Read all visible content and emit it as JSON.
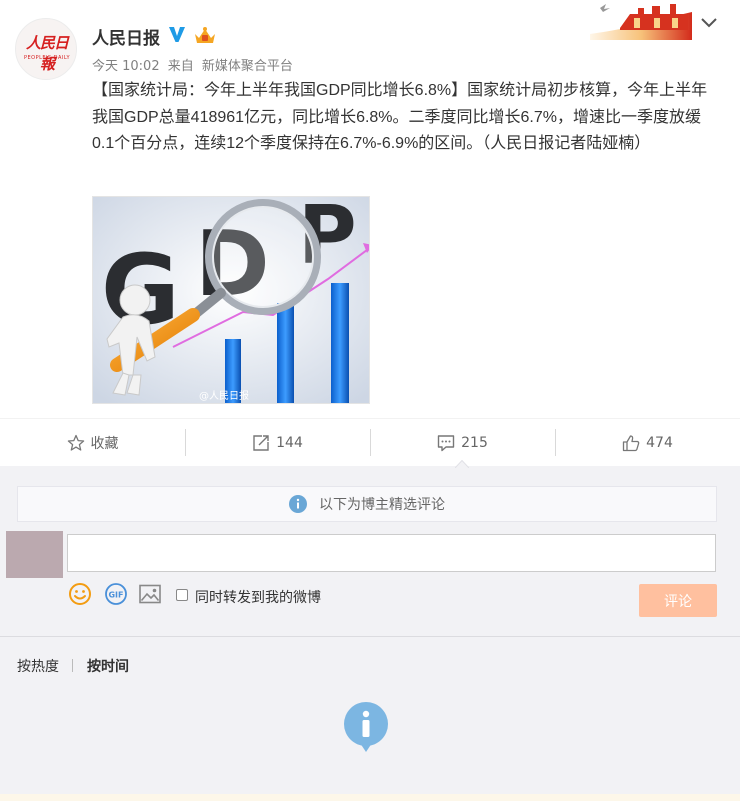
{
  "post": {
    "avatar_logo": "人民日報",
    "avatar_logo_en": "PEOPLE'S DAILY",
    "username": "人民日报",
    "time": "今天 10:02",
    "source_prefix": "来自",
    "source": "新媒体聚合平台",
    "text": "【国家统计局：今年上半年我国GDP同比增长6.8%】国家统计局初步核算，今年上半年我国GDP总量418961亿元，同比增长6.8%。二季度同比增长6.7%，增速比一季度放缓0.1个百分点，连续12个季度保持在6.7%-6.9%的区间。（人民日报记者陆娅楠）",
    "image": {
      "letters": "GDP",
      "watermark": "@人民日报"
    }
  },
  "actions": {
    "favorite": "收藏",
    "repost": "144",
    "comment": "215",
    "like": "474"
  },
  "comments": {
    "notice": "以下为博主精选评论",
    "input_value": "",
    "repost_label": "同时转发到我的微博",
    "submit": "评论",
    "sort_hot": "按热度",
    "sort_time": "按时间"
  },
  "colors": {
    "accent_orange": "#ffc09f",
    "info_blue": "#6aa7d6",
    "verified_blue": "#1f9be6"
  },
  "icons": [
    "verified-icon",
    "crown-icon",
    "chevron-down-icon",
    "star-icon",
    "repost-icon",
    "comment-icon",
    "like-icon",
    "info-icon",
    "emoji-icon",
    "gif-icon",
    "image-icon"
  ]
}
